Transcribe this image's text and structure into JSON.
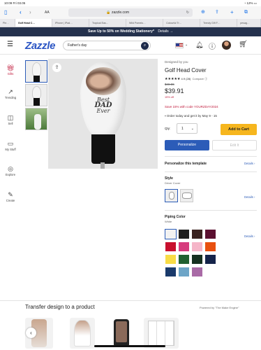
{
  "status": {
    "time": "10:09",
    "date": "Fri 03.05",
    "battery": "12%"
  },
  "browser": {
    "aa": "AA",
    "url": "zazzle.com",
    "tabs": [
      "Ple…",
      "Golf Head C…",
      "iPhone | iPad…",
      "Tropical Eas…",
      "Wild Pomelo…",
      "Colourful Tr…",
      "Trendy Gift F…",
      "pesag…"
    ]
  },
  "promo": {
    "text": "Save Up to 50% on Wedding Stationery*",
    "link": "Details →"
  },
  "header": {
    "logo": "Zazzle",
    "search_value": "Father's day"
  },
  "rail": [
    {
      "icon": "gift-icon",
      "label": "Gifts"
    },
    {
      "icon": "trending-icon",
      "label": "Trending"
    },
    {
      "icon": "sell-icon",
      "label": "Sell"
    },
    {
      "icon": "folder-icon",
      "label": "My Stuff"
    },
    {
      "icon": "explore-icon",
      "label": "Explore"
    },
    {
      "icon": "create-icon",
      "label": "Create"
    }
  ],
  "product": {
    "designed_by": "Designed by you",
    "title": "Golf Head Cover",
    "rating": "4.9 (28)",
    "compare": "Compare",
    "old_price": "$46.55",
    "price": "$39.91",
    "off": "15% off",
    "sale": "Save 15% with code YOURZDAY2024",
    "order_note": "Order today and get it by May 9 - 15",
    "qty_label": "Qty:",
    "qty_value": "1",
    "add_to_cart": "Add to Cart",
    "personalize": "Personalize",
    "edit": "Edit It",
    "personalize_template": "Personalize this template",
    "details": "Details"
  },
  "style": {
    "label": "Style",
    "value": "Driver Cover"
  },
  "piping": {
    "label": "Piping Color",
    "value": "White",
    "colors": [
      "#f2f2f2",
      "#1f1f1f",
      "#3b2320",
      "#5b1030",
      "#c8102e",
      "#d63c7d",
      "#f5b5c8",
      "#e8500f",
      "#f8dc46",
      "#206030",
      "#163020",
      "#15244a",
      "#1a3a6b",
      "#6da5c7",
      "#a96aa6"
    ]
  },
  "mug_text": {
    "line1": "Best",
    "line2": "DAD",
    "line3": "Ever"
  },
  "bottom": {
    "title": "Transfer design to a product",
    "powered": "Powered by \"The Make Engine\""
  }
}
